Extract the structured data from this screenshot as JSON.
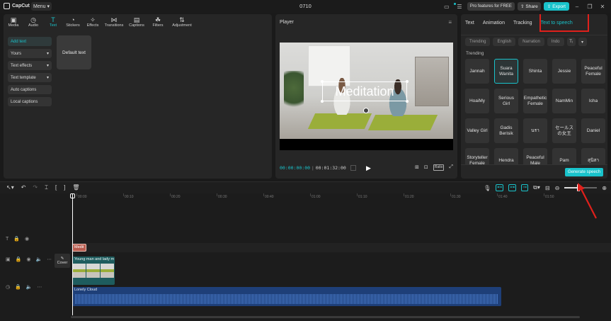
{
  "app": {
    "name": "CapCut",
    "menu_label": "Menu",
    "project_title": "0710",
    "pro_label": "Pro features for FREE",
    "share_label": "Share",
    "export_label": "Export"
  },
  "toolbar": {
    "tabs": [
      {
        "label": "Media",
        "icon": "media-icon"
      },
      {
        "label": "Audio",
        "icon": "audio-icon"
      },
      {
        "label": "Text",
        "icon": "text-icon",
        "active": true
      },
      {
        "label": "Stickers",
        "icon": "sticker-icon"
      },
      {
        "label": "Effects",
        "icon": "effects-icon"
      },
      {
        "label": "Transitions",
        "icon": "transition-icon"
      },
      {
        "label": "Captions",
        "icon": "captions-icon"
      },
      {
        "label": "Filters",
        "icon": "filters-icon"
      },
      {
        "label": "Adjustment",
        "icon": "adjust-icon"
      }
    ]
  },
  "text_sidebar": {
    "items": [
      {
        "label": "Add text"
      },
      {
        "label": "Yours"
      },
      {
        "label": "Text effects"
      },
      {
        "label": "Text template"
      },
      {
        "label": "Auto captions"
      },
      {
        "label": "Local captions"
      }
    ],
    "default_card": "Default text"
  },
  "player": {
    "title": "Player",
    "overlay_text": "Meditation",
    "time_current": "00:00:00:00",
    "time_total": "00:01:32:00",
    "ratio_label": "Ratio"
  },
  "right_panel": {
    "tabs": [
      {
        "label": "Text"
      },
      {
        "label": "Animation"
      },
      {
        "label": "Tracking"
      },
      {
        "label": "Text to speech",
        "active": true
      }
    ],
    "filters": [
      "Trending",
      "English",
      "Narration",
      "Indo"
    ],
    "section_label": "Trending",
    "voices": [
      "Jannah",
      "Suara Wanita",
      "Shinta",
      "Jessie",
      "Peaceful Female",
      "HoaiMy",
      "Serious Girl",
      "Empathetic Female",
      "NamMin",
      "Icha",
      "Valley Girl",
      "Gadis Berisik",
      "นรา",
      "セールスの女王",
      "Daniel",
      "Storyteller Female",
      "Hendra",
      "Peaceful Male",
      "Pam",
      "สุนิสา"
    ],
    "selected_voice": "Suara Wanita",
    "generate_label": "Generate speech"
  },
  "timeline": {
    "ruler_ticks": [
      "00:00",
      "00:10",
      "00:20",
      "00:30",
      "00:40",
      "01:00",
      "01:10",
      "01:20",
      "01:30",
      "01:40",
      "01:50"
    ],
    "text_clip_label": "Medit",
    "video_clip_label": "Young man and lady m",
    "cover_label": "Cover",
    "audio_clip_label": "Lonely Cloud"
  },
  "colors": {
    "accent": "#19c3cb",
    "highlight_box": "#e0201b",
    "audio_clip": "#1e3f78",
    "video_clip": "#1e5c5e",
    "text_clip": "#b85c4f"
  }
}
